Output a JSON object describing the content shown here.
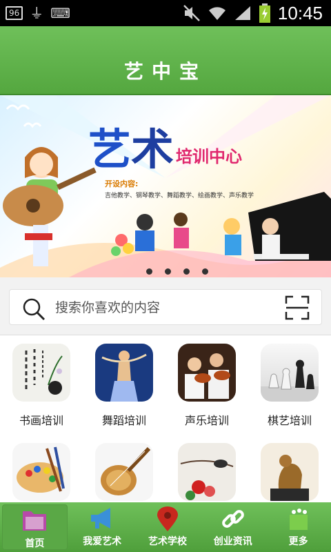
{
  "status": {
    "badge": "96",
    "time": "10:45",
    "icons": [
      "usb-icon",
      "keyboard-icon",
      "mute-icon",
      "wifi-icon",
      "signal-icon",
      "battery-charging-icon"
    ]
  },
  "header": {
    "title": "艺中宝"
  },
  "banner": {
    "slide_count": 4,
    "active_index": 0
  },
  "search": {
    "placeholder": "搜索你喜欢的内容"
  },
  "categories": [
    {
      "label": "书画培训",
      "icon": "calligraphy-image"
    },
    {
      "label": "舞蹈培训",
      "icon": "dance-image"
    },
    {
      "label": "声乐培训",
      "icon": "violin-image"
    },
    {
      "label": "棋艺培训",
      "icon": "chess-image"
    },
    {
      "label": "",
      "icon": "palette-image"
    },
    {
      "label": "",
      "icon": "lute-image"
    },
    {
      "label": "",
      "icon": "bird-painting-image"
    },
    {
      "label": "",
      "icon": "sculpture-image"
    }
  ],
  "nav": [
    {
      "label": "首页",
      "icon": "folder-icon",
      "active": true
    },
    {
      "label": "我爱艺术",
      "icon": "megaphone-icon",
      "active": false
    },
    {
      "label": "艺术学校",
      "icon": "location-pin-icon",
      "active": false
    },
    {
      "label": "创业资讯",
      "icon": "link-icon",
      "active": false
    },
    {
      "label": "更多",
      "icon": "more-icon",
      "active": false
    }
  ],
  "colors": {
    "brand_green": "#5cad47",
    "nav_green": "#54a73f"
  }
}
